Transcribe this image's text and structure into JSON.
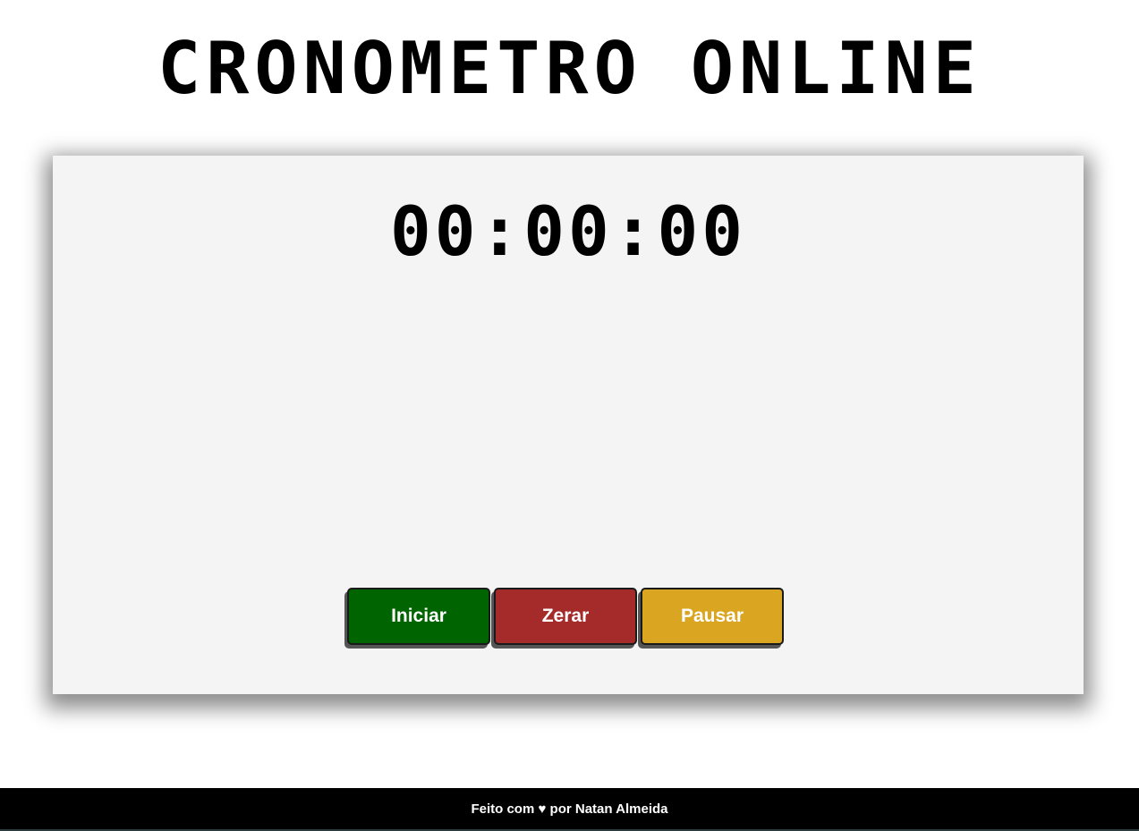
{
  "header": {
    "title": "CRONOMETRO ONLINE"
  },
  "stopwatch": {
    "time": "00:00:00",
    "buttons": {
      "start": {
        "label": "Iniciar",
        "color": "#006400"
      },
      "reset": {
        "label": "Zerar",
        "color": "#a52a2a"
      },
      "pause": {
        "label": "Pausar",
        "color": "#daa520"
      }
    }
  },
  "footer": {
    "credit": "Feito com ♥ por Natan Almeida"
  }
}
